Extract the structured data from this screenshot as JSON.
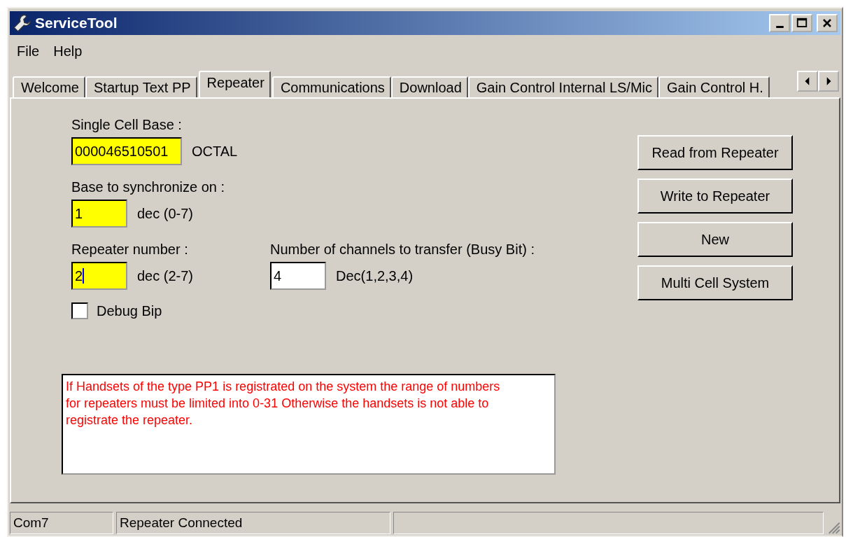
{
  "window": {
    "title": "ServiceTool"
  },
  "menu": [
    "File",
    "Help"
  ],
  "tabs": [
    {
      "label": "Welcome",
      "selected": false
    },
    {
      "label": "Startup Text PP",
      "selected": false
    },
    {
      "label": "Repeater",
      "selected": true
    },
    {
      "label": "Communications",
      "selected": false
    },
    {
      "label": "Download",
      "selected": false
    },
    {
      "label": "Gain Control Internal LS/Mic",
      "selected": false
    },
    {
      "label": "Gain Control H.",
      "selected": false
    }
  ],
  "fields": [
    {
      "label": "Single Cell Base :",
      "value": "000046510501",
      "unit": "OCTAL",
      "highlighted": true,
      "focused": false
    },
    {
      "label": "Base to synchronize on :",
      "value": "1",
      "unit": "dec (0-7)",
      "highlighted": true,
      "focused": false
    },
    {
      "label": "Repeater number :",
      "value": "2",
      "unit": "dec (2-7)",
      "highlighted": true,
      "focused": true
    },
    {
      "label": "Number of channels to transfer (Busy Bit) :",
      "value": "4",
      "unit": "Dec(1,2,3,4)",
      "highlighted": false,
      "focused": false
    }
  ],
  "debug_checkbox": {
    "label": "Debug Bip",
    "checked": false
  },
  "buttons": [
    "Read from Repeater",
    "Write to Repeater",
    "New",
    "Multi Cell System"
  ],
  "message": "If Handsets of the type PP1 is registrated on the system the range of numbers for repeaters must be limited into 0-31 Otherwise the handsets is not able to registrate the repeater.",
  "status_bar": [
    "Com7",
    "Repeater Connected"
  ]
}
